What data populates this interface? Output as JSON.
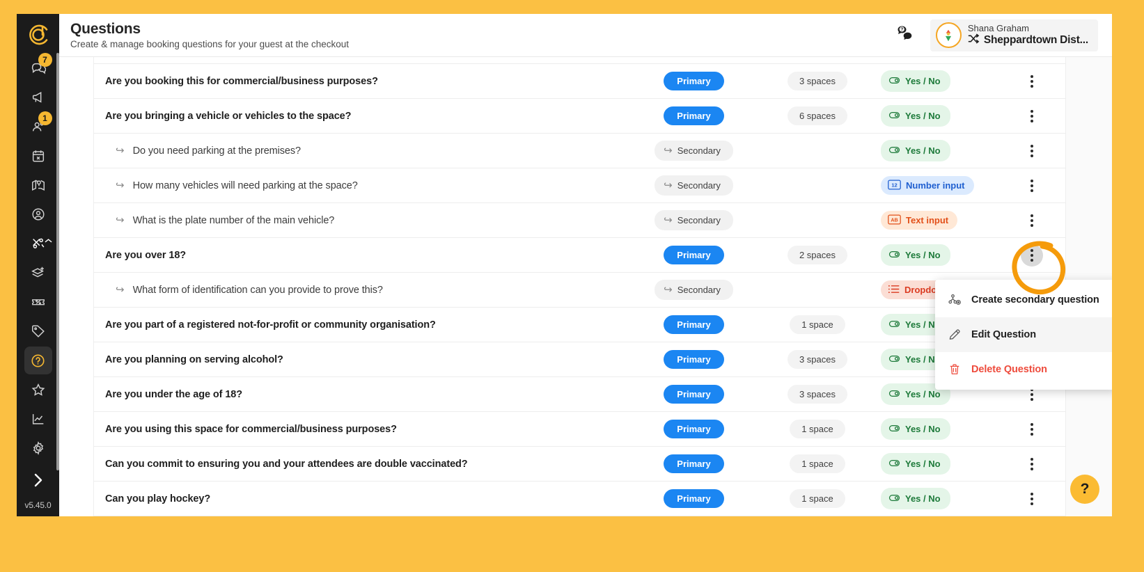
{
  "app": {
    "version": "v5.45.0",
    "logo": "concentric-c-logo",
    "expand_icon": "chevron-right-icon"
  },
  "colors": {
    "page_background": "#FBC043",
    "sidebar": "#1b1b1b",
    "brand_yellow": "#F5B731",
    "primary_blue": "#1B86F2",
    "accent_orange": "#F59B0B",
    "danger_red": "#EE4B3C",
    "yesno_green": "#1d7a3a"
  },
  "sidebar": {
    "items": [
      {
        "icon": "chat-bubbles-icon",
        "label": "Messages",
        "badge": "7",
        "active": false
      },
      {
        "icon": "megaphone-icon",
        "label": "Announcements",
        "badge": "",
        "active": false
      },
      {
        "icon": "user-group-icon",
        "label": "Users",
        "badge": "1",
        "active": false
      },
      {
        "icon": "calendar-x-icon",
        "label": "Calendar",
        "badge": "",
        "active": false
      },
      {
        "icon": "map-pin-icon",
        "label": "Map",
        "badge": "",
        "active": false
      },
      {
        "icon": "user-circle-icon",
        "label": "Account",
        "badge": "",
        "active": false
      },
      {
        "icon": "tools-icon",
        "label": "Tools",
        "badge": "",
        "active": false,
        "chevron": "chevron-up-icon"
      },
      {
        "icon": "layers-plus-icon",
        "label": "Spaces",
        "badge": "",
        "active": false
      },
      {
        "icon": "ticket-percent-icon",
        "label": "Discounts",
        "badge": "",
        "active": false
      },
      {
        "icon": "tag-icon",
        "label": "Tags",
        "badge": "",
        "active": false
      },
      {
        "icon": "question-circle-icon",
        "label": "Questions",
        "badge": "",
        "active": true
      },
      {
        "icon": "star-icon",
        "label": "Reviews",
        "badge": "",
        "active": false
      },
      {
        "icon": "line-chart-icon",
        "label": "Reports",
        "badge": "",
        "active": false
      },
      {
        "icon": "gear-icon",
        "label": "Settings",
        "badge": "",
        "active": false
      }
    ]
  },
  "header": {
    "title": "Questions",
    "subtitle": "Create & manage booking questions for your guest at the checkout",
    "chat_icon": "chat-question-icon",
    "account": {
      "avatar_icon": "org-crest-avatar",
      "name": "Shana Graham",
      "switch_icon": "shuffle-icon",
      "org": "Sheppardtown Dist..."
    }
  },
  "table": {
    "rows": [
      {
        "text": "Are you booking this for commercial/business purposes?",
        "level": "Primary",
        "level_kind": "primary",
        "spaces": "3 spaces",
        "type": "Yes / No",
        "type_kind": "yesno",
        "type_icon": "toggle-icon"
      },
      {
        "text": "Are you bringing a vehicle or vehicles to the space?",
        "level": "Primary",
        "level_kind": "primary",
        "spaces": "6 spaces",
        "type": "Yes / No",
        "type_kind": "yesno",
        "type_icon": "toggle-icon"
      },
      {
        "text": "Do you need parking at the premises?",
        "level": "Secondary",
        "level_kind": "secondary",
        "spaces": "",
        "type": "Yes / No",
        "type_kind": "yesno",
        "type_icon": "toggle-icon"
      },
      {
        "text": "How many vehicles will need parking at the space?",
        "level": "Secondary",
        "level_kind": "secondary",
        "spaces": "",
        "type": "Number input",
        "type_kind": "number",
        "type_icon": "number-12-icon"
      },
      {
        "text": "What is the plate number of the main vehicle?",
        "level": "Secondary",
        "level_kind": "secondary",
        "spaces": "",
        "type": "Text input",
        "type_kind": "text",
        "type_icon": "ab-text-icon"
      },
      {
        "text": "Are you over 18?",
        "level": "Primary",
        "level_kind": "primary",
        "spaces": "2 spaces",
        "type": "Yes / No",
        "type_kind": "yesno",
        "type_icon": "toggle-icon",
        "menu_open": true
      },
      {
        "text": "What form of identification can you provide to prove this?",
        "level": "Secondary",
        "level_kind": "secondary",
        "spaces": "",
        "type": "Dropdown",
        "type_kind": "dropdown",
        "type_icon": "list-icon"
      },
      {
        "text": "Are you part of a registered not-for-profit or community organisation?",
        "level": "Primary",
        "level_kind": "primary",
        "spaces": "1 space",
        "type": "Yes / No",
        "type_kind": "yesno",
        "type_icon": "toggle-icon"
      },
      {
        "text": "Are you planning on serving alcohol?",
        "level": "Primary",
        "level_kind": "primary",
        "spaces": "3 spaces",
        "type": "Yes / No",
        "type_kind": "yesno",
        "type_icon": "toggle-icon"
      },
      {
        "text": "Are you under the age of 18?",
        "level": "Primary",
        "level_kind": "primary",
        "spaces": "3 spaces",
        "type": "Yes / No",
        "type_kind": "yesno",
        "type_icon": "toggle-icon"
      },
      {
        "text": "Are you using this space for commercial/business purposes?",
        "level": "Primary",
        "level_kind": "primary",
        "spaces": "1 space",
        "type": "Yes / No",
        "type_kind": "yesno",
        "type_icon": "toggle-icon"
      },
      {
        "text": "Can you commit to ensuring you and your attendees are double vaccinated?",
        "level": "Primary",
        "level_kind": "primary",
        "spaces": "1 space",
        "type": "Yes / No",
        "type_kind": "yesno",
        "type_icon": "toggle-icon"
      },
      {
        "text": "Can you play hockey?",
        "level": "Primary",
        "level_kind": "primary",
        "spaces": "1 space",
        "type": "Yes / No",
        "type_kind": "yesno",
        "type_icon": "toggle-icon"
      }
    ]
  },
  "context_menu": {
    "items": [
      {
        "label": "Create secondary question",
        "icon": "hierarchy-plus-icon",
        "kind": "normal",
        "hovered": false
      },
      {
        "label": "Edit Question",
        "icon": "pencil-icon",
        "kind": "normal",
        "hovered": true
      },
      {
        "label": "Delete Question",
        "icon": "trash-icon",
        "kind": "danger",
        "hovered": false
      }
    ]
  },
  "help_fab": {
    "label": "?"
  }
}
